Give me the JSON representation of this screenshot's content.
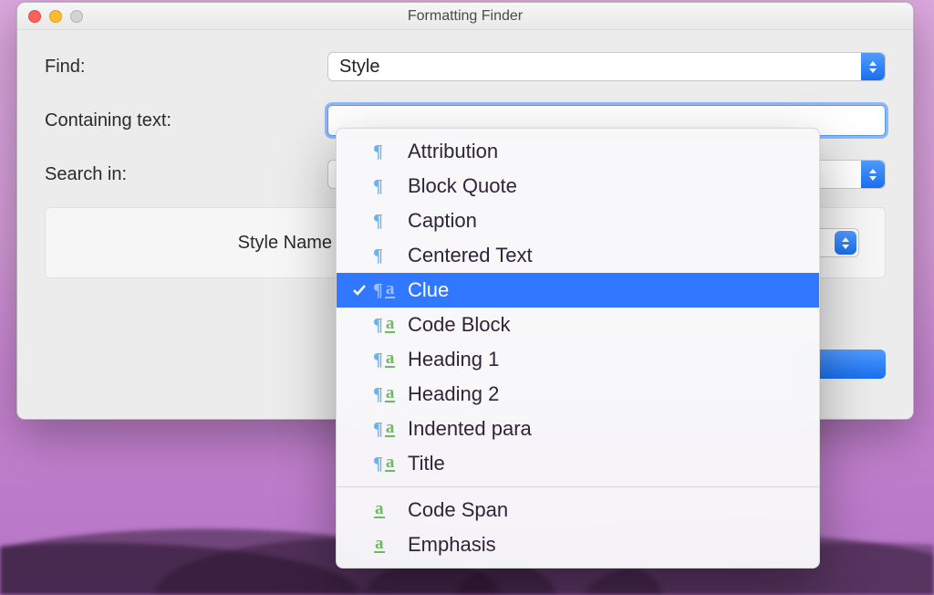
{
  "window": {
    "title": "Formatting Finder"
  },
  "form": {
    "find_label": "Find:",
    "find_value": "Style",
    "containing_label": "Containing text:",
    "searchin_label": "Search in:",
    "stylename_label": "Style Name"
  },
  "dropdown": {
    "selected_index": 4,
    "groups": [
      {
        "items": [
          {
            "label": "Attribution",
            "icon": "para"
          },
          {
            "label": "Block Quote",
            "icon": "para"
          },
          {
            "label": "Caption",
            "icon": "para"
          },
          {
            "label": "Centered Text",
            "icon": "para"
          },
          {
            "label": "Clue",
            "icon": "both"
          },
          {
            "label": "Code Block",
            "icon": "both"
          },
          {
            "label": "Heading 1",
            "icon": "both"
          },
          {
            "label": "Heading 2",
            "icon": "both"
          },
          {
            "label": "Indented para",
            "icon": "both"
          },
          {
            "label": "Title",
            "icon": "both"
          }
        ]
      },
      {
        "items": [
          {
            "label": "Code Span",
            "icon": "char"
          },
          {
            "label": "Emphasis",
            "icon": "char"
          }
        ]
      }
    ]
  }
}
